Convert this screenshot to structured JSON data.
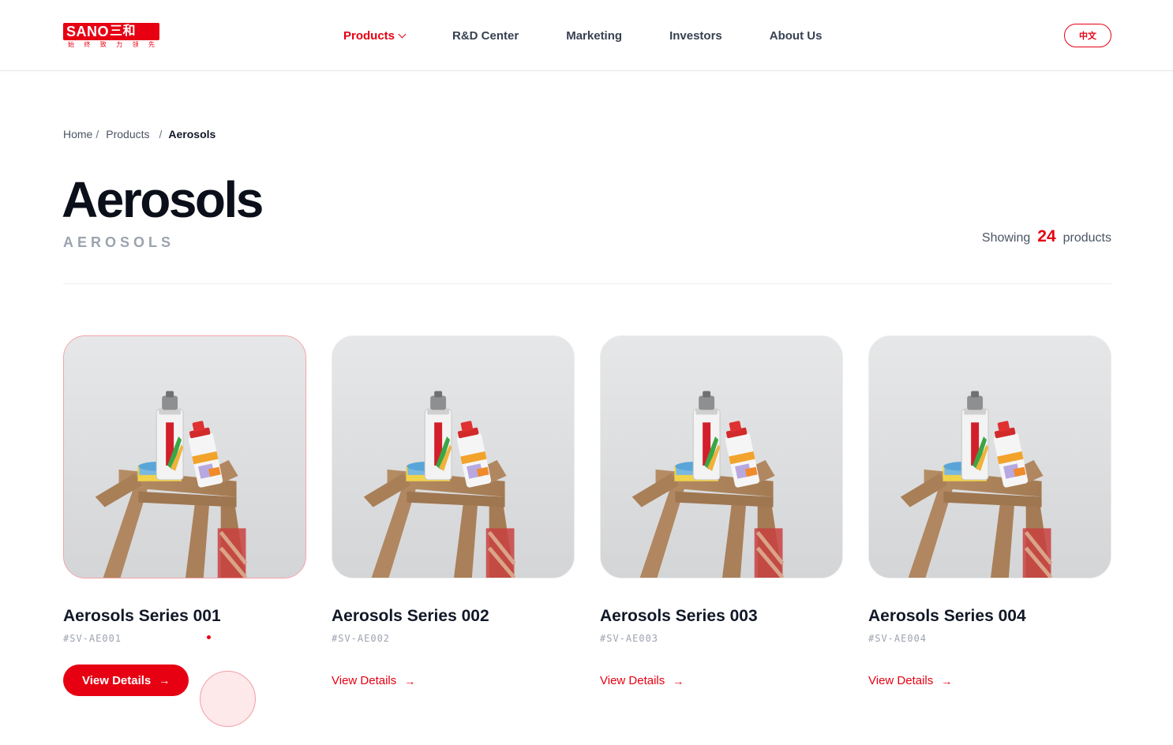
{
  "header": {
    "logo_text": "SANO",
    "logo_zh": "三和",
    "logo_tagline": [
      "始",
      "终",
      "致",
      "力",
      "领",
      "先"
    ],
    "nav": [
      {
        "label": "Products",
        "active": true
      },
      {
        "label": "R&D Center",
        "active": false
      },
      {
        "label": "Marketing",
        "active": false
      },
      {
        "label": "Investors",
        "active": false
      },
      {
        "label": "About Us",
        "active": false
      }
    ],
    "lang_label": "中文"
  },
  "breadcrumb": {
    "home": "Home",
    "products": "Products",
    "current": "Aerosols"
  },
  "page": {
    "title": "Aerosols",
    "subtitle": "AEROSOLS",
    "showing_prefix": "Showing",
    "count": "24",
    "showing_suffix": "products"
  },
  "products": [
    {
      "title": "Aerosols Series 001",
      "code": "#SV-AE001",
      "cta": "View Details",
      "hover": true
    },
    {
      "title": "Aerosols Series 002",
      "code": "#SV-AE002",
      "cta": "View Details",
      "hover": false
    },
    {
      "title": "Aerosols Series 003",
      "code": "#SV-AE003",
      "cta": "View Details",
      "hover": false
    },
    {
      "title": "Aerosols Series 004",
      "code": "#SV-AE004",
      "cta": "View Details",
      "hover": false
    }
  ],
  "colors": {
    "accent": "#e60012",
    "text_dark": "#0b0f1a",
    "muted": "#9ca3af"
  },
  "icons": {
    "nav_dropdown": "chevron-down-icon",
    "cta_arrow": "arrow-right-icon"
  }
}
